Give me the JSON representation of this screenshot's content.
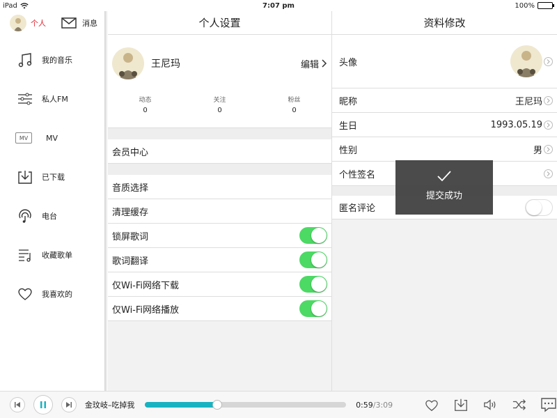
{
  "status": {
    "device": "iPad",
    "time": "7:07 pm",
    "battery": "100%"
  },
  "sidebar": {
    "me_label": "个人",
    "messages_label": "消息",
    "items": [
      {
        "label": "我的音乐",
        "icon": "music-note-icon"
      },
      {
        "label": "私人FM",
        "icon": "sliders-icon"
      },
      {
        "label": "MV",
        "icon": "mv-icon"
      },
      {
        "label": "已下载",
        "icon": "download-icon"
      },
      {
        "label": "电台",
        "icon": "radio-icon"
      },
      {
        "label": "收藏歌单",
        "icon": "playlist-icon"
      },
      {
        "label": "我喜欢的",
        "icon": "heart-icon"
      }
    ],
    "mv_badge": "MV"
  },
  "settings": {
    "title": "个人设置",
    "profile_name": "王尼玛",
    "edit_label": "编辑",
    "stats": [
      {
        "title": "动态",
        "value": "0"
      },
      {
        "title": "关注",
        "value": "0"
      },
      {
        "title": "粉丝",
        "value": "0"
      }
    ],
    "vip_center": "会员中心",
    "quality": "音质选择",
    "clear_cache": "清理缓存",
    "toggles": [
      {
        "label": "锁屏歌词",
        "on": true
      },
      {
        "label": "歌词翻译",
        "on": true
      },
      {
        "label": "仅Wi-Fi网络下载",
        "on": true
      },
      {
        "label": "仅Wi-Fi网络播放",
        "on": true
      }
    ]
  },
  "edit": {
    "title": "资料修改",
    "avatar_label": "头像",
    "nickname_label": "昵称",
    "nickname_value": "王尼玛",
    "birthday_label": "生日",
    "birthday_value": "1993.05.19",
    "gender_label": "性别",
    "gender_value": "男",
    "signature_label": "个性签名",
    "anonymous_label": "匿名评论",
    "anonymous_on": false
  },
  "toast": {
    "message": "提交成功"
  },
  "player": {
    "track": "金玟岐–吃掉我",
    "elapsed": "0:59",
    "total": "/3:09",
    "progress": 0.36,
    "accent": "#17b3c1"
  }
}
